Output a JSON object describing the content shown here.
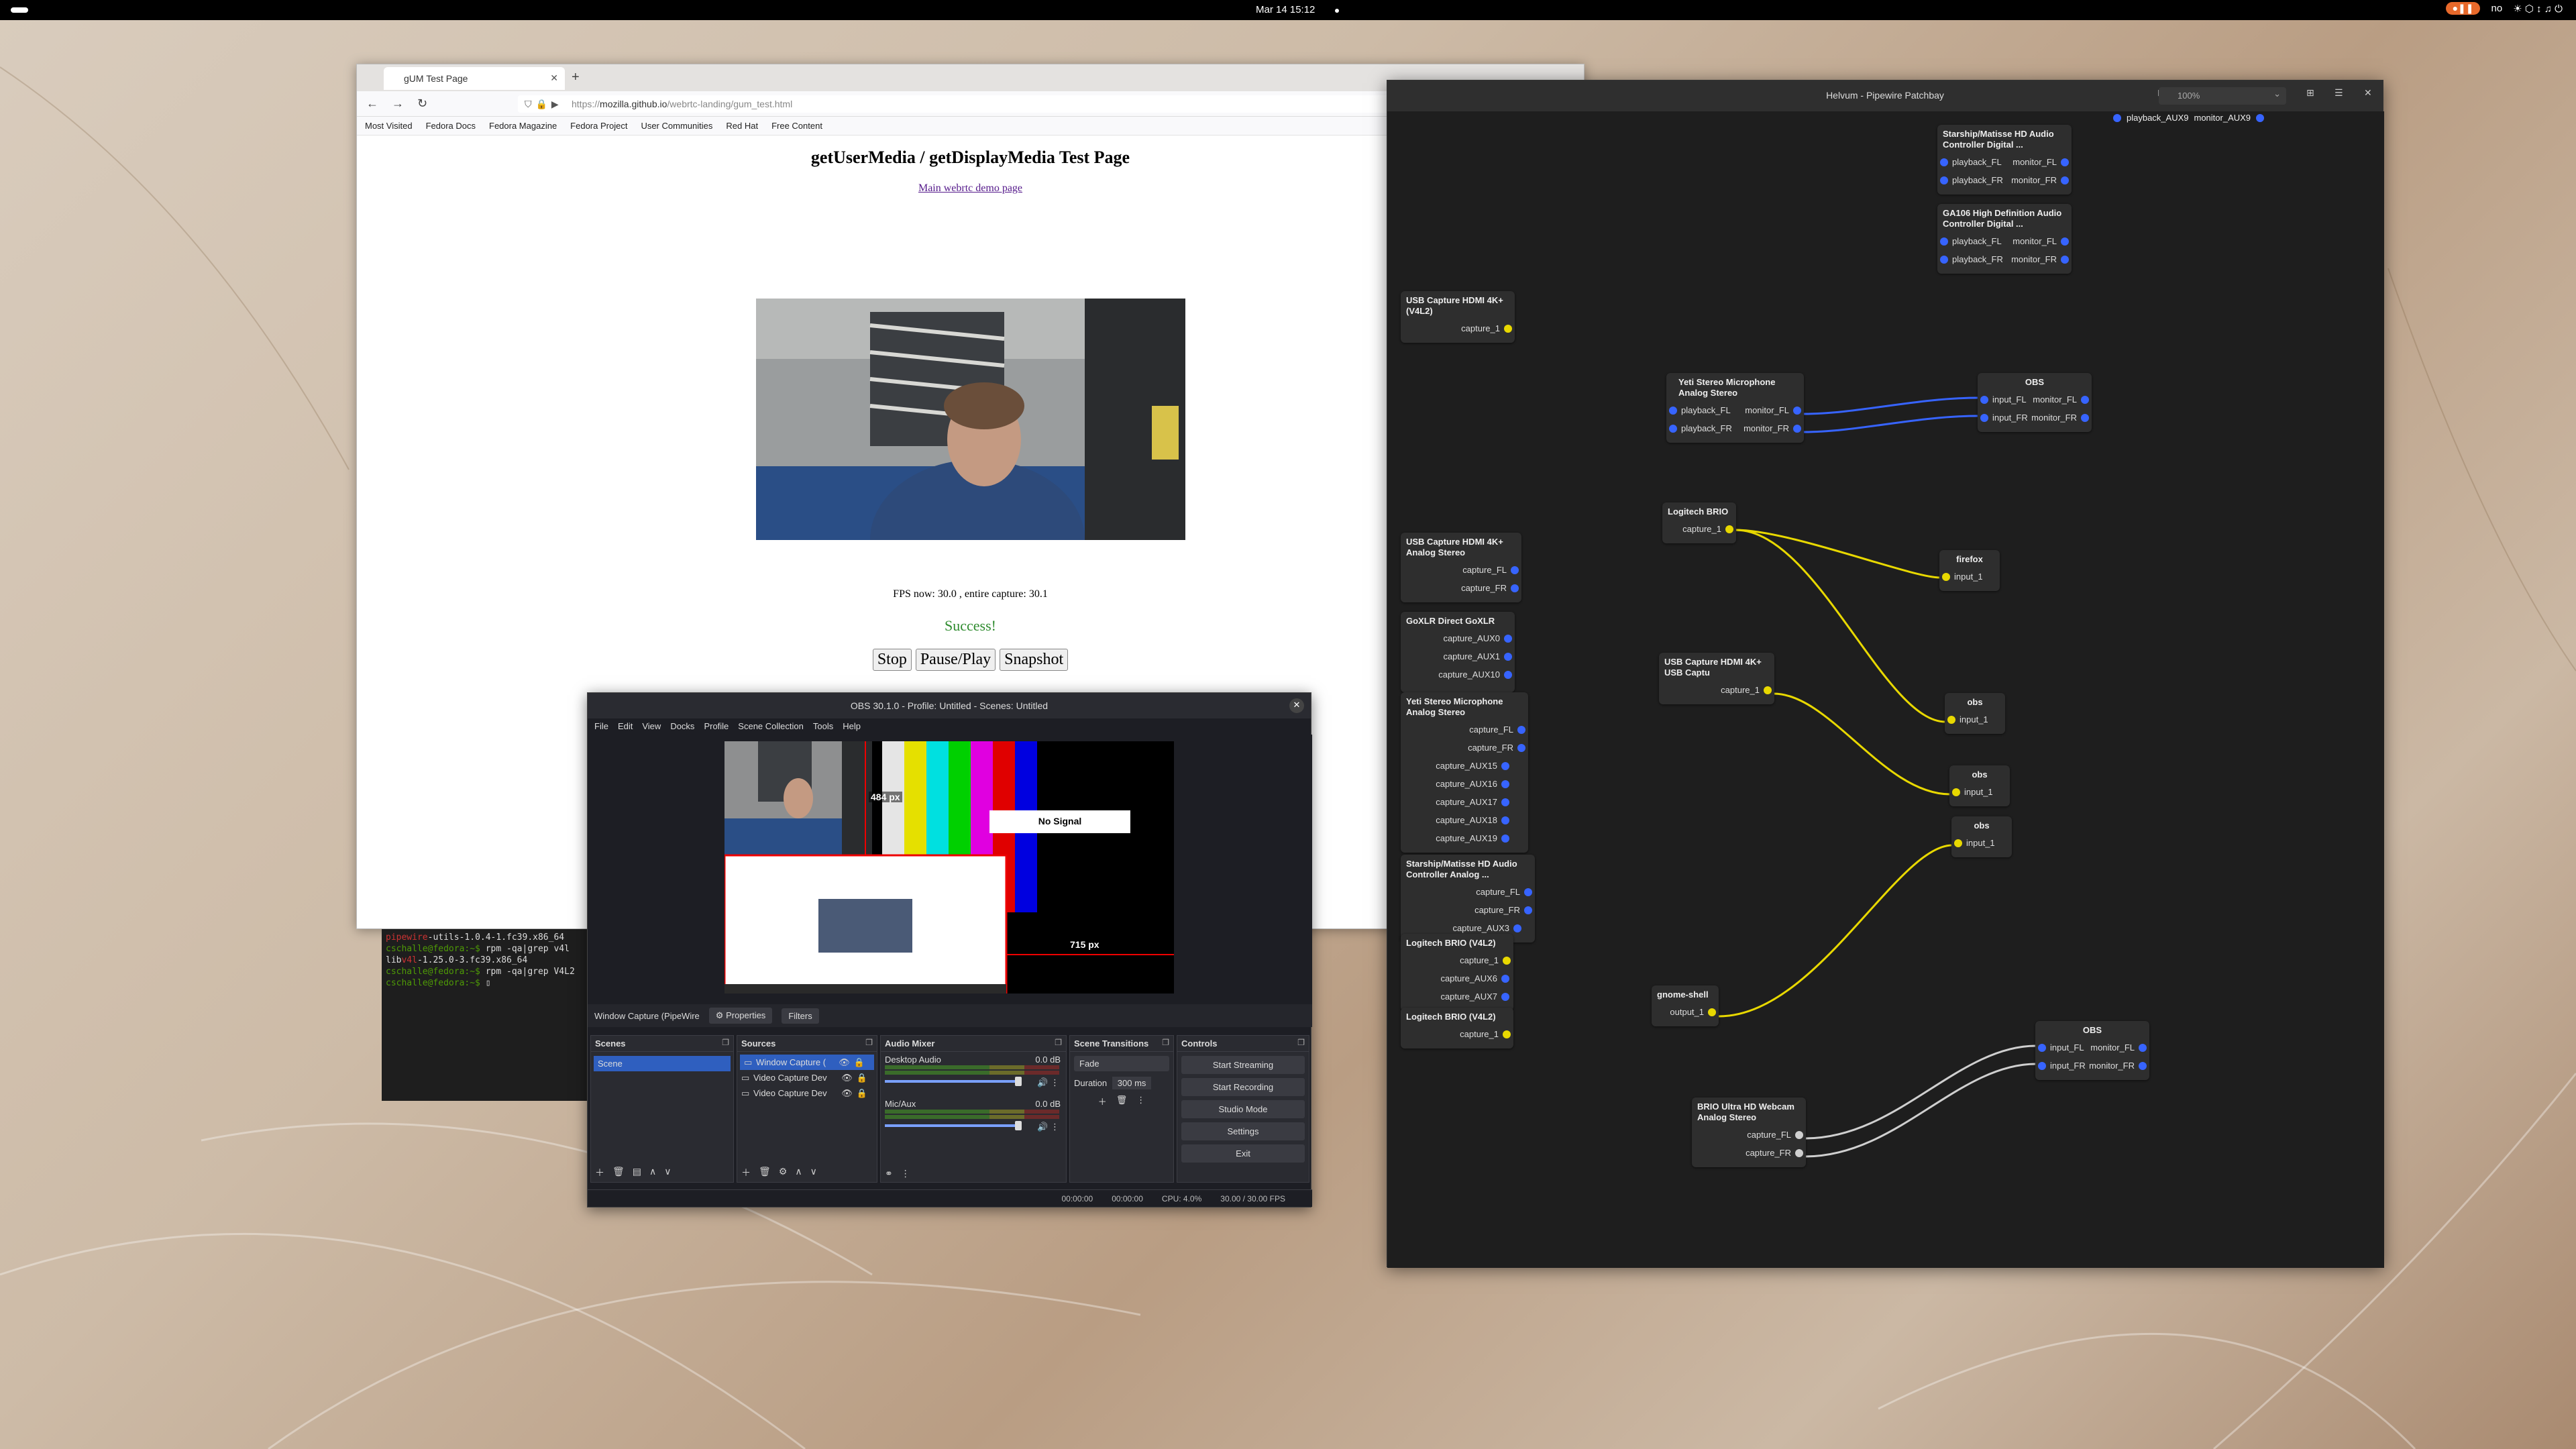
{
  "topbar": {
    "clock": "Mar 14  15:12",
    "indicator": "●❚❚",
    "lang": "no",
    "sys_icons": "☀ ⬡ ↕ ♫ ⏻"
  },
  "firefox": {
    "tab_title": "gUM Test Page",
    "url_prefix": "https://",
    "url_host": "mozilla.github.io",
    "url_path": "/webrtc-landing/gum_test.html",
    "bookmarks": [
      "Most Visited",
      "Fedora Docs",
      "Fedora Magazine",
      "Fedora Project",
      "User Communities",
      "Red Hat",
      "Free Content"
    ],
    "heading": "getUserMedia / getDisplayMedia Test Page",
    "link": "Main webrtc demo page",
    "fps": "FPS now: 30.0 , entire capture: 30.1",
    "success": "Success!",
    "buttons": {
      "stop": "Stop",
      "pause": "Pause/Play",
      "snapshot": "Snapshot"
    }
  },
  "terminal": {
    "l1a": "pipewire",
    "l1b": "-utils-1.0.4-1.fc39.x86_64",
    "l2p": "cschalle@fedora:~$",
    "l2c": " rpm -qa|grep v4l",
    "l3a": "lib",
    "l3b": "v4l",
    "l3c": "-1.25.0-3.fc39.x86_64",
    "l4p": "cschalle@fedora:~$",
    "l4c": " rpm -qa|grep V4L2",
    "l5p": "cschalle@fedora:~$"
  },
  "obs": {
    "title": "OBS 30.1.0 - Profile: Untitled - Scenes: Untitled",
    "menu": [
      "File",
      "Edit",
      "View",
      "Docks",
      "Profile",
      "Scene Collection",
      "Tools",
      "Help"
    ],
    "preview": {
      "no_signal": "No Signal",
      "dim_v": "484 px",
      "dim_h": "715 px"
    },
    "source_bar": {
      "name": "Window Capture (PipeWire",
      "properties": "Properties",
      "filters": "Filters"
    },
    "scenes": {
      "header": "Scenes",
      "items": [
        "Scene"
      ]
    },
    "sources": {
      "header": "Sources",
      "items": [
        "Window Capture (",
        "Video Capture Dev",
        "Video Capture Dev"
      ]
    },
    "mixer": {
      "header": "Audio Mixer",
      "channels": [
        {
          "name": "Desktop Audio",
          "db": "0.0 dB"
        },
        {
          "name": "Mic/Aux",
          "db": "0.0 dB"
        }
      ]
    },
    "transitions": {
      "header": "Scene Transitions",
      "type": "Fade",
      "duration_label": "Duration",
      "duration": "300 ms"
    },
    "controls": {
      "header": "Controls",
      "buttons": [
        "Start Streaming",
        "Start Recording",
        "Studio Mode",
        "Settings",
        "Exit"
      ]
    },
    "status": {
      "time1": "00:00:00",
      "time2": "00:00:00",
      "cpu": "CPU: 4.0%",
      "fps": "30.00 / 30.00 FPS"
    }
  },
  "helvum": {
    "title": "Helvum - Pipewire Patchbay",
    "zoom": "100%",
    "top_ports": {
      "left": "playback_AUX9",
      "right": "monitor_AUX9"
    },
    "nodes": {
      "starship_digital": {
        "title": "Starship/Matisse HD Audio Controller Digital ...",
        "in": [
          "playback_FL",
          "playback_FR"
        ],
        "out": [
          "monitor_FL",
          "monitor_FR"
        ]
      },
      "ga106": {
        "title": "GA106 High Definition Audio Controller Digital ...",
        "in": [
          "playback_FL",
          "playback_FR"
        ],
        "out": [
          "monitor_FL",
          "monitor_FR"
        ]
      },
      "usb_hdmi_v4l2": {
        "title": "USB Capture HDMI 4K+ (V4L2)",
        "out": [
          "capture_1"
        ]
      },
      "yeti_out": {
        "title": "Yeti Stereo Microphone Analog Stereo",
        "in": [
          "playback_FL",
          "playback_FR"
        ],
        "out": [
          "monitor_FL",
          "monitor_FR"
        ]
      },
      "obs_audio1": {
        "title": "OBS",
        "in": [
          "input_FL",
          "input_FR"
        ],
        "out": [
          "monitor_FL",
          "monitor_FR"
        ]
      },
      "logitech_brio": {
        "title": "Logitech BRIO",
        "out": [
          "capture_1"
        ]
      },
      "firefox": {
        "title": "firefox",
        "in": [
          "input_1"
        ]
      },
      "usb_hdmi_analog": {
        "title": "USB Capture HDMI 4K+ Analog Stereo",
        "out": [
          "capture_FL",
          "capture_FR"
        ]
      },
      "goxlr": {
        "title": "GoXLR Direct GoXLR",
        "out": [
          "capture_AUX0",
          "capture_AUX1",
          "capture_AUX10"
        ]
      },
      "usb_hdmi_captu": {
        "title": "USB Capture HDMI 4K+ USB Captu",
        "out": [
          "capture_1"
        ]
      },
      "obs_v1": {
        "title": "obs",
        "in": [
          "input_1"
        ]
      },
      "yeti_in": {
        "title": "Yeti Stereo Microphone Analog Stereo",
        "out": [
          "capture_FL",
          "capture_FR",
          "capture_AUX15",
          "capture_AUX16",
          "capture_AUX17",
          "capture_AUX18",
          "capture_AUX19"
        ]
      },
      "obs_v2": {
        "title": "obs",
        "in": [
          "input_1"
        ]
      },
      "obs_v3": {
        "title": "obs",
        "in": [
          "input_1"
        ]
      },
      "starship_analog": {
        "title": "Starship/Matisse HD Audio Controller Analog ...",
        "out": [
          "capture_FL",
          "capture_FR",
          "capture_AUX3"
        ]
      },
      "brio_v4l2_a": {
        "title": "Logitech BRIO (V4L2)",
        "out": [
          "capture_1",
          "capture_AUX6",
          "capture_AUX7"
        ]
      },
      "brio_v4l2_b": {
        "title": "Logitech BRIO (V4L2)",
        "out": [
          "capture_1"
        ]
      },
      "gnome_shell": {
        "title": "gnome-shell",
        "out": [
          "output_1"
        ]
      },
      "obs_audio2": {
        "title": "OBS",
        "in": [
          "input_FL",
          "input_FR"
        ],
        "out": [
          "monitor_FL",
          "monitor_FR"
        ]
      },
      "brio_webcam": {
        "title": "BRIO Ultra HD Webcam Analog Stereo",
        "out": [
          "capture_FL",
          "capture_FR"
        ]
      }
    }
  }
}
